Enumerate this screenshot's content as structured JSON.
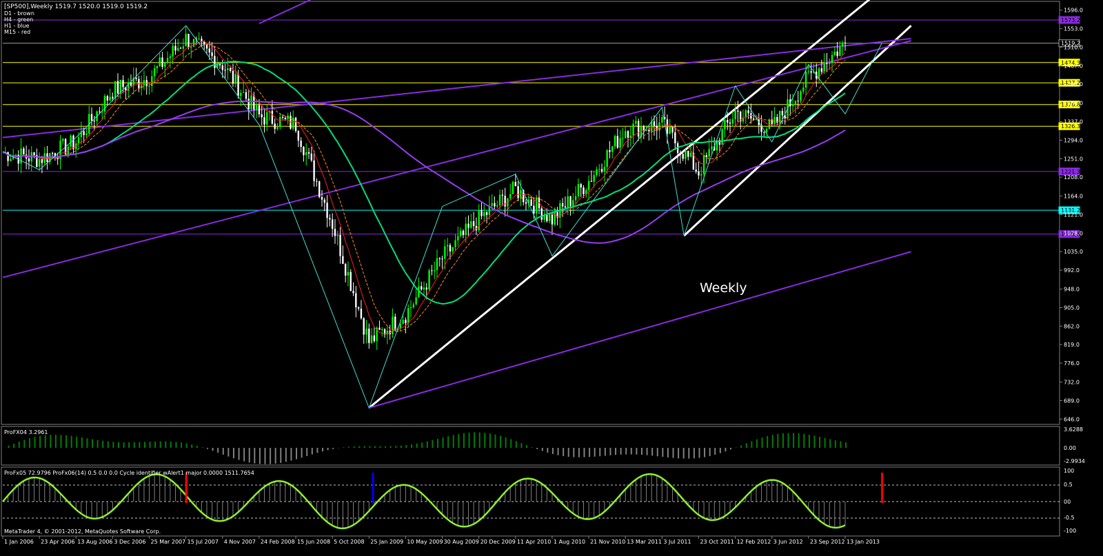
{
  "header": {
    "symbol_line": "[SP500],Weekly  1519.7 1520.0 1519.0 1519.2",
    "legend": [
      "D1 - brown",
      "H4 - green",
      "H1 - blue",
      "M15 - red"
    ]
  },
  "annotation": "Weekly",
  "footer": "MetaQuotes Software Corp.",
  "footer_prefix": "MetaTrader 4, © 2001-2012, ",
  "colors": {
    "background": "#000000",
    "bull_candle": "#00ff00",
    "bear_candle": "#ffffff",
    "ma_green": "#00e07a",
    "ma_purple": "#9a3cf0",
    "ma_red": "#ff2020",
    "ma_orange": "#ff8c1a",
    "level_yellow": "#ffff00",
    "level_purple": "#8a2be2",
    "level_cyan": "#00ffff",
    "trendline": "#ffffff",
    "osc_positive": "#008000",
    "osc_negative": "#808080",
    "cycle_line": "#90ee30"
  },
  "chart_data": [
    {
      "type": "line",
      "name": "main",
      "x": [
        "1 Jan 2006",
        "23 Apr 2006",
        "13 Aug 2006",
        "3 Dec 2006",
        "25 Mar 2007",
        "15 Jul 2007",
        "4 Nov 2007",
        "24 Feb 2008",
        "15 Jun 2008",
        "5 Oct 2008",
        "25 Jan 2009",
        "10 May 2009",
        "30 Aug 2009",
        "20 Dec 2009",
        "11 Apr 2010",
        "1 Aug 2010",
        "21 Nov 2010",
        "13 Mar 2011",
        "3 Jul 2011",
        "23 Oct 2011",
        "12 Feb 2012",
        "3 Jun 2012",
        "23 Sep 2012",
        "13 Jan 2013"
      ],
      "price_close": [
        1265,
        1250,
        1290,
        1410,
        1440,
        1530,
        1470,
        1350,
        1330,
        1100,
        825,
        890,
        1020,
        1110,
        1180,
        1110,
        1200,
        1320,
        1330,
        1220,
        1360,
        1320,
        1440,
        1519.2
      ],
      "ylim": [
        640,
        1610
      ],
      "y_ticks": [
        646.0,
        689.0,
        732.0,
        776.0,
        819.0,
        862.0,
        905.0,
        948.0,
        992.0,
        1035.0,
        1078.0,
        1121.0,
        1164.0,
        1208.0,
        1251.0,
        1294.0,
        1337.0,
        1380.0,
        1424.0,
        1467.0,
        1510.0,
        1553.0,
        1596.0
      ],
      "levels": [
        {
          "value": 1573.2,
          "color": "purple"
        },
        {
          "value": 1519.2,
          "color": "white"
        },
        {
          "value": 1474.3,
          "color": "yellow"
        },
        {
          "value": 1427.2,
          "color": "yellow"
        },
        {
          "value": 1376.8,
          "color": "yellow"
        },
        {
          "value": 1326.3,
          "color": "yellow"
        },
        {
          "value": 1221.3,
          "color": "purple"
        },
        {
          "value": 1131.2,
          "color": "cyan"
        },
        {
          "value": 1075.8,
          "color": "purple"
        }
      ]
    },
    {
      "type": "area",
      "name": "ProFX04",
      "label": "ProFX04 3.2961",
      "ylim": [
        -2.9934,
        3.6288
      ],
      "y_ticks": [
        "3.6288",
        "0.00",
        "-2.9934"
      ]
    },
    {
      "type": "line",
      "name": "cycle",
      "label": "ProFx05 72.9796  ProFx06(14) 0.5 0.0 0.0  Cycle identifier wAlert1 major 0.0000 1511.7654",
      "ylim": [
        -100,
        100
      ],
      "y_ticks": [
        "100",
        "0.5",
        "00",
        "-0.5",
        "-100"
      ]
    }
  ]
}
